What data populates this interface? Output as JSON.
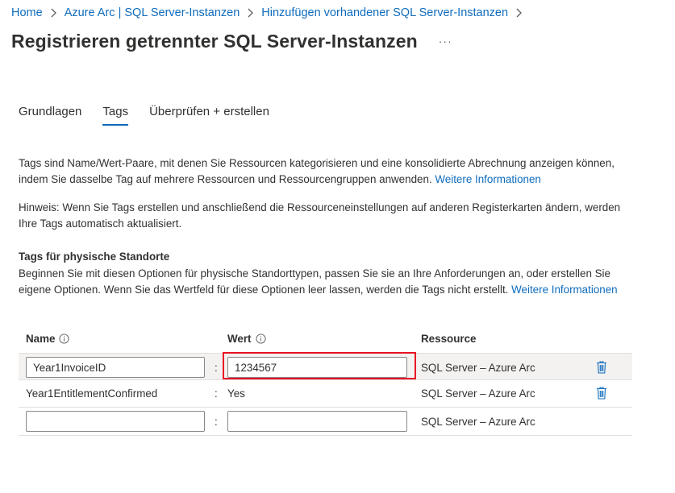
{
  "breadcrumb": [
    {
      "label": "Home"
    },
    {
      "label": "Azure Arc | SQL Server-Instanzen"
    },
    {
      "label": "Hinzufügen vorhandener SQL Server-Instanzen"
    }
  ],
  "page": {
    "title": "Registrieren getrennter SQL Server-Instanzen",
    "more_label": "···"
  },
  "tabs": [
    {
      "label": "Grundlagen",
      "active": false
    },
    {
      "label": "Tags",
      "active": true
    },
    {
      "label": "Überprüfen + erstellen",
      "active": false
    }
  ],
  "intro": {
    "text": "Tags sind Name/Wert-Paare, mit denen Sie Ressourcen kategorisieren und eine konsolidierte Abrechnung anzeigen können, indem Sie dasselbe Tag auf mehrere Ressourcen und Ressourcengruppen anwenden. ",
    "link": "Weitere Informationen"
  },
  "note": {
    "text": "Hinweis: Wenn Sie Tags erstellen und anschließend die Ressourceneinstellungen auf anderen Registerkarten ändern, werden Ihre Tags automatisch aktualisiert."
  },
  "physical": {
    "title": "Tags für physische Standorte",
    "text": "Beginnen Sie mit diesen Optionen für physische Standorttypen, passen Sie sie an Ihre Anforderungen an, oder erstellen Sie eigene Optionen. Wenn Sie das Wertfeld für diese Optionen leer lassen, werden die Tags nicht erstellt. ",
    "link": "Weitere Informationen"
  },
  "table": {
    "headers": {
      "name": "Name",
      "value": "Wert",
      "resource": "Ressource"
    },
    "separator": ":",
    "rows": [
      {
        "name": "Year1InvoiceID",
        "value": "1234567",
        "resource": "SQL Server – Azure Arc"
      },
      {
        "name": "Year1EntitlementConfirmed",
        "value": "Yes",
        "resource": "SQL Server – Azure Arc"
      },
      {
        "name": "",
        "value": "",
        "resource": "SQL Server – Azure Arc"
      }
    ]
  },
  "colors": {
    "accent": "#0f6cbd",
    "highlight": "#e81123",
    "row_selected": "#f3f2f1"
  },
  "icons": [
    "chevron-right-icon",
    "info-icon",
    "delete-icon"
  ]
}
